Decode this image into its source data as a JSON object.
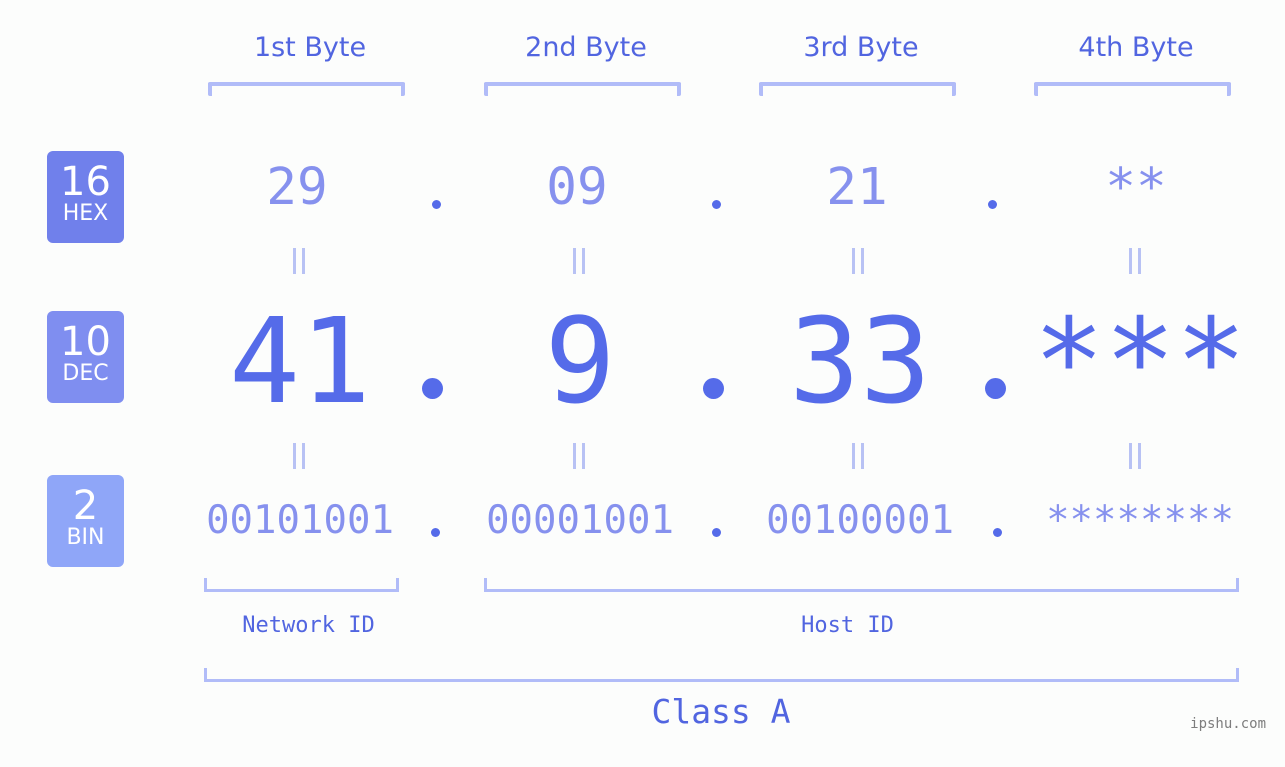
{
  "bytes": {
    "headers": [
      "1st Byte",
      "2nd Byte",
      "3rd Byte",
      "4th Byte"
    ]
  },
  "bases": {
    "hex": {
      "num": "16",
      "label": "HEX"
    },
    "dec": {
      "num": "10",
      "label": "DEC"
    },
    "bin": {
      "num": "2",
      "label": "BIN"
    }
  },
  "ip": {
    "hex": [
      "29",
      "09",
      "21",
      "**"
    ],
    "dec": [
      "41",
      "9",
      "33",
      "***"
    ],
    "bin": [
      "00101001",
      "00001001",
      "00100001",
      "********"
    ],
    "separator": "."
  },
  "segments": {
    "network": "Network ID",
    "host": "Host ID",
    "class": "Class A"
  },
  "watermark": "ipshu.com",
  "colors": {
    "accent": "#556be9",
    "light_value": "#8691ee",
    "bracket": "#b1bcf8",
    "hex_badge": "#7080eb",
    "dec_badge": "#7f8ef0",
    "bin_badge": "#8fa6f8"
  }
}
